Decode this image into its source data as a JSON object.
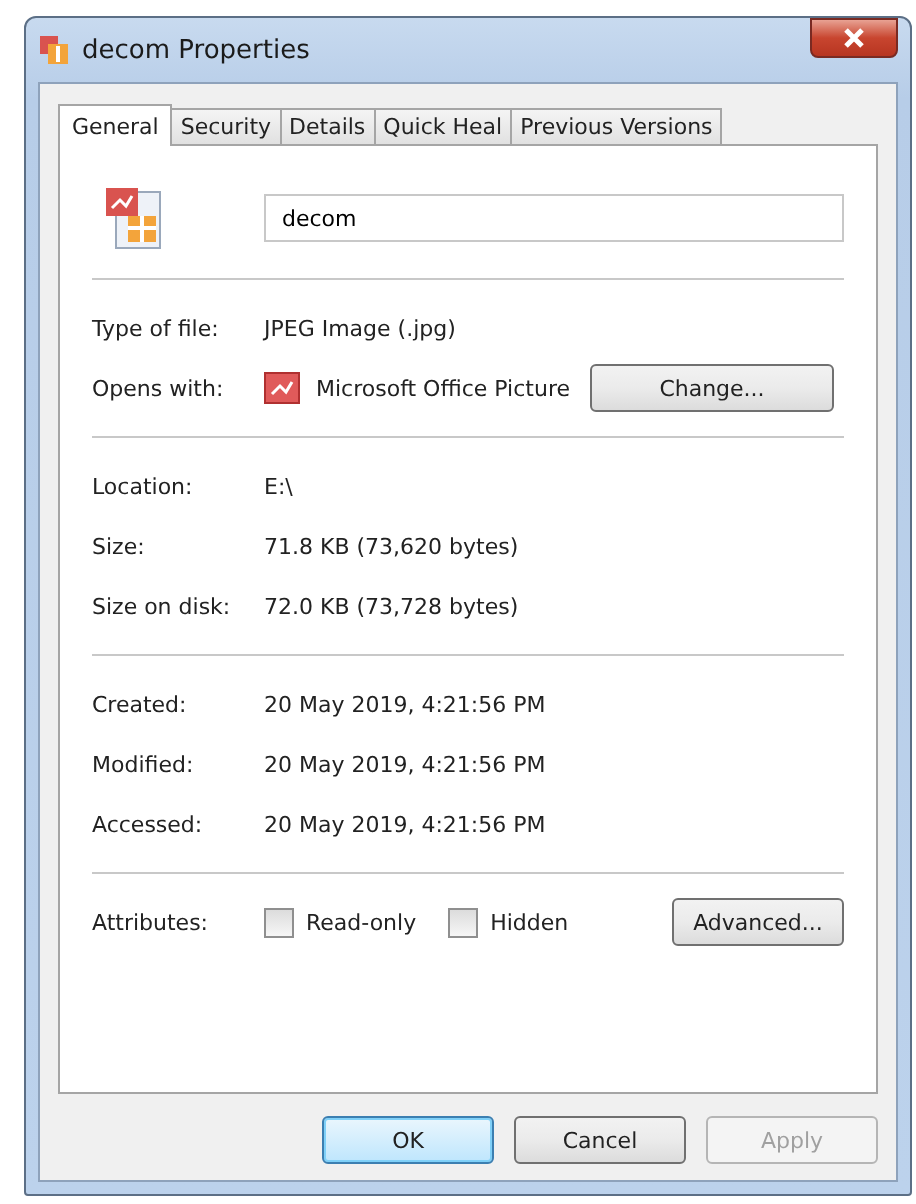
{
  "window": {
    "title": "decom Properties"
  },
  "tabs": [
    {
      "label": "General",
      "selected": true
    },
    {
      "label": "Security",
      "selected": false
    },
    {
      "label": "Details",
      "selected": false
    },
    {
      "label": "Quick Heal",
      "selected": false
    },
    {
      "label": "Previous Versions",
      "selected": false
    }
  ],
  "file_name": {
    "value": "decom"
  },
  "sections": [
    [
      {
        "kind": "text",
        "label": "Type of file:",
        "value": "JPEG Image (.jpg)"
      },
      {
        "kind": "app",
        "label": "Opens with:",
        "value": "Microsoft Office Picture",
        "button": "Change..."
      }
    ],
    [
      {
        "kind": "text",
        "label": "Location:",
        "value": "E:\\"
      },
      {
        "kind": "text",
        "label": "Size:",
        "value": "71.8 KB (73,620 bytes)"
      },
      {
        "kind": "text",
        "label": "Size on disk:",
        "value": "72.0 KB (73,728 bytes)"
      }
    ],
    [
      {
        "kind": "text",
        "label": "Created:",
        "value": "20 May 2019, 4:21:56 PM"
      },
      {
        "kind": "text",
        "label": "Modified:",
        "value": "20 May 2019, 4:21:56 PM"
      },
      {
        "kind": "text",
        "label": "Accessed:",
        "value": "20 May 2019, 4:21:56 PM"
      }
    ],
    [
      {
        "kind": "attributes",
        "label": "Attributes:",
        "checkboxes": [
          {
            "label": "Read-only",
            "checked": false
          },
          {
            "label": "Hidden",
            "checked": false
          }
        ],
        "button": "Advanced..."
      }
    ]
  ],
  "buttons": [
    {
      "label": "OK",
      "default": true,
      "disabled": false
    },
    {
      "label": "Cancel",
      "default": false,
      "disabled": false
    },
    {
      "label": "Apply",
      "default": false,
      "disabled": true
    }
  ]
}
